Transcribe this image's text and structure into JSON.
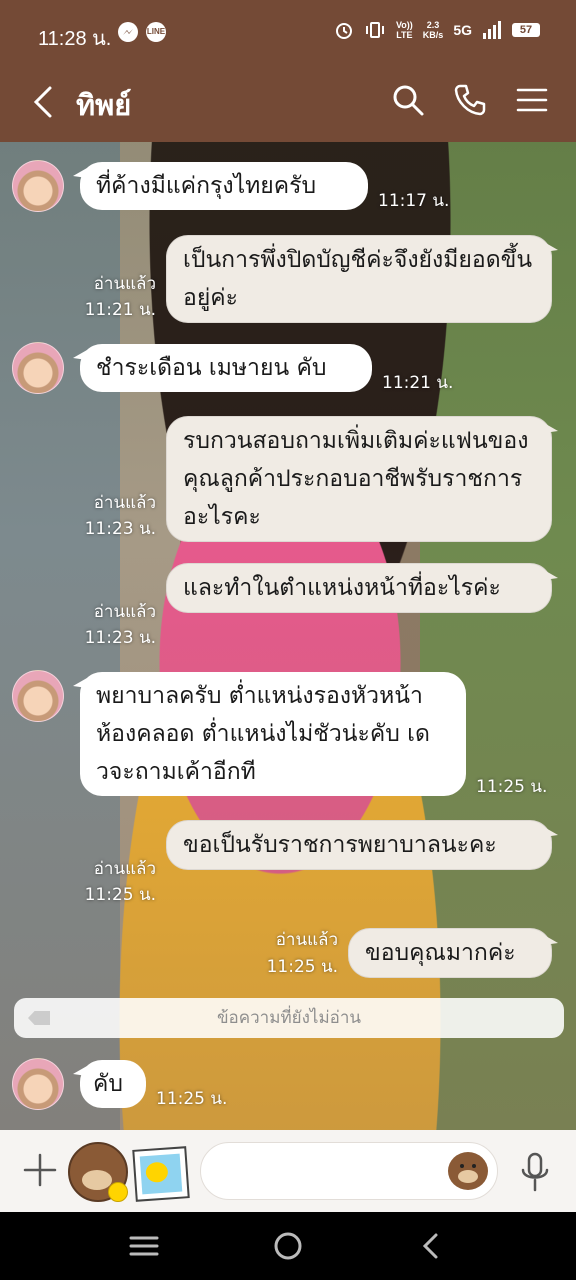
{
  "status_bar": {
    "time": "11:28 น.",
    "app_icon_line": "LINE",
    "lte_top": "Vo))",
    "lte_bottom": "LTE",
    "speed_top": "2.3",
    "speed_bottom": "KB/s",
    "network": "5G",
    "battery": "57"
  },
  "header": {
    "title": "ทิพย์"
  },
  "messages": [
    {
      "side": "in",
      "text": "ที่ค้างมีแค่กรุงไทยครับ",
      "time": "11:17 น."
    },
    {
      "side": "out",
      "text": "เป็นการพึ่งปิดบัญชีค่ะจึงยังมียอดขึ้นอยู่ค่ะ",
      "read": "อ่านแล้ว",
      "time": "11:21 น."
    },
    {
      "side": "in",
      "text": "ชำระเดือน เมษายน คับ",
      "time": "11:21 น."
    },
    {
      "side": "out",
      "text": "รบกวนสอบถามเพิ่มเติมค่ะแฟนของคุณลูกค้าประกอบอาชีพรับราชการอะไรคะ",
      "read": "อ่านแล้ว",
      "time": "11:23 น."
    },
    {
      "side": "out",
      "text": "และทำในตำแหน่งหน้าที่อะไรค่ะ",
      "read": "อ่านแล้ว",
      "time": "11:23 น."
    },
    {
      "side": "in",
      "text": "พยาบาลครับ ต่ำแหน่งรองหัวหน้าห้องคลอด ต่ำแหน่งไม่ชัวน่ะคับ เดวจะถามเค้าอีกที",
      "time": "11:25 น."
    },
    {
      "side": "out",
      "text": "ขอเป็นรับราชการพยาบาลนะคะ",
      "read": "อ่านแล้ว",
      "time": "11:25 น."
    },
    {
      "side": "out",
      "text": "ขอบคุณมากค่ะ",
      "read": "อ่านแล้ว",
      "time": "11:25 น."
    },
    {
      "side": "in",
      "text": "คับ",
      "time": "11:25 น."
    }
  ],
  "unread_divider": "ข้อความที่ยังไม่อ่าน",
  "input": {
    "value": "",
    "placeholder": ""
  },
  "icons": {
    "back": "chevron-left-icon",
    "search": "search-icon",
    "call": "phone-icon",
    "menu": "hamburger-icon",
    "plus": "plus-icon",
    "mic": "microphone-icon"
  },
  "colors": {
    "header": "#744a36",
    "bubble_in": "#ffffff",
    "bubble_out": "#f0ebe4",
    "input_bar": "#f6f4f2"
  }
}
